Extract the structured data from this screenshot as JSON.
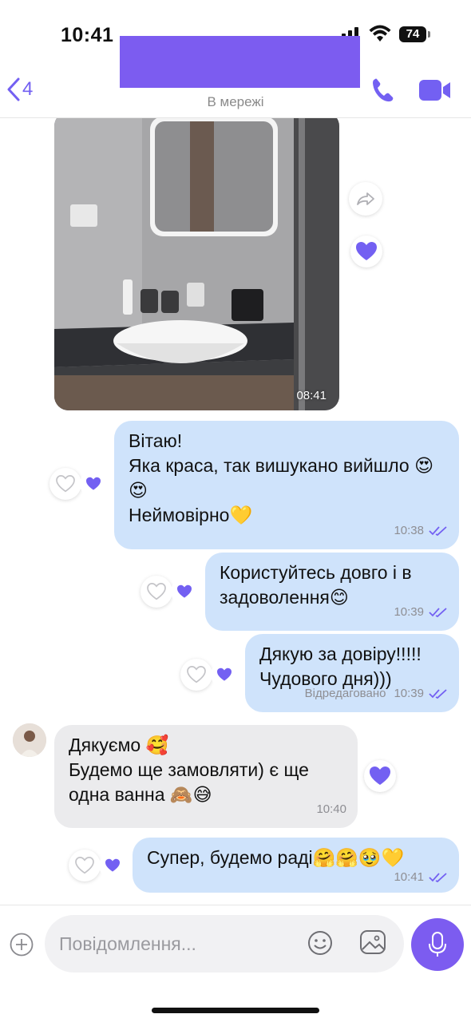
{
  "status_bar": {
    "time": "10:41",
    "battery": "74"
  },
  "header": {
    "back_count": "4",
    "contact_status": "В мережі"
  },
  "colors": {
    "accent": "#7360f2",
    "outgoing_bubble": "#cfe3fb",
    "incoming_bubble": "#ebebed"
  },
  "photo": {
    "time": "08:41"
  },
  "messages": [
    {
      "direction": "out",
      "text": "Вітаю!\nЯка краса, так вишукано вийшло 😍😍\nНеймовірно💛",
      "time": "10:38",
      "edited": ""
    },
    {
      "direction": "out",
      "text": "Користуйтесь довго і в задоволення😊",
      "time": "10:39",
      "edited": ""
    },
    {
      "direction": "out",
      "text": "Дякую за довіру!!!!!\nЧудового дня)))",
      "time": "10:39",
      "edited": "Відредаговано"
    },
    {
      "direction": "in",
      "text": "Дякуємо 🥰\nБудемо ще замовляти) є ще одна ванна 🙈😅",
      "time": "10:40",
      "edited": ""
    },
    {
      "direction": "out",
      "text": "Супер, будемо раді🤗🤗🥹💛",
      "time": "10:41",
      "edited": ""
    }
  ],
  "composer": {
    "placeholder": "Повідомлення..."
  },
  "icons": [
    "back-chevron-icon",
    "phone-icon",
    "video-camera-icon",
    "share-icon",
    "heart-icon",
    "plus-icon",
    "emoji-icon",
    "sticker-icon",
    "microphone-icon"
  ]
}
